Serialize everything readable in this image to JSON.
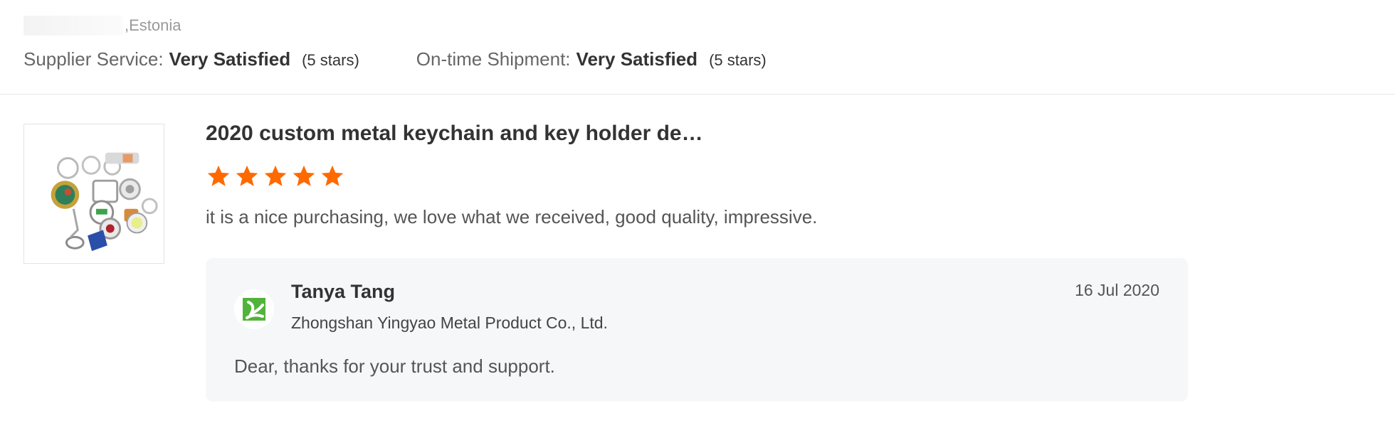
{
  "buyer": {
    "location": ",Estonia"
  },
  "ratings": {
    "supplier_service": {
      "label": "Supplier Service:",
      "value": "Very Satisfied",
      "stars": "(5 stars)"
    },
    "on_time_shipment": {
      "label": "On-time Shipment:",
      "value": "Very Satisfied",
      "stars": "(5 stars)"
    }
  },
  "review": {
    "product_title": "2020 custom metal keychain and key holder de…",
    "rating": 5,
    "star_color": "#ff6a00",
    "text": "it is a nice purchasing, we love what we received, good quality, impressive."
  },
  "reply": {
    "name": "Tanya Tang",
    "company": "Zhongshan Yingyao Metal Product Co., Ltd.",
    "date": "16 Jul 2020",
    "text": "Dear, thanks for your trust and support.",
    "avatar_color": "#52b33b"
  }
}
